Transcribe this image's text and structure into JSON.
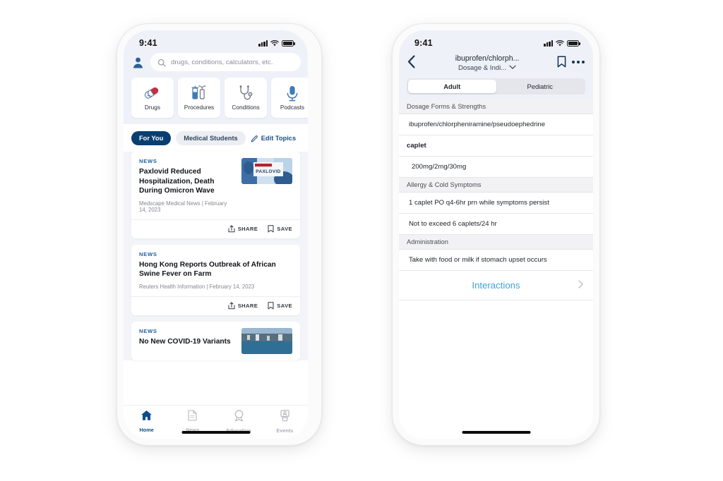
{
  "phone1": {
    "status": {
      "time": "9:41",
      "signal_icon": "cellular-bars-icon",
      "wifi_icon": "wifi-icon",
      "battery_icon": "battery-full-icon"
    },
    "header": {
      "avatar_icon": "user-avatar-icon",
      "search": {
        "icon": "search-icon",
        "placeholder": "drugs, conditions, calculators, etc.",
        "value": ""
      }
    },
    "quick_tiles": [
      {
        "label": "Drugs",
        "icon": "pills-capsule-icon"
      },
      {
        "label": "Procedures",
        "icon": "syringe-procedures-icon"
      },
      {
        "label": "Conditions",
        "icon": "stethoscope-icon"
      },
      {
        "label": "Podcasts",
        "icon": "microphone-icon"
      }
    ],
    "topics": {
      "chips": [
        {
          "label": "For You",
          "active": true
        },
        {
          "label": "Medical Students",
          "active": false
        }
      ],
      "edit_label": "Edit Topics",
      "edit_icon": "pencil-edit-icon"
    },
    "feed": [
      {
        "kicker": "NEWS",
        "headline": "Paxlovid Reduced Hospitalization, Death During Omicron Wave",
        "byline": "Medscape Medical News | February 14, 2023",
        "thumbnail": "paxlovid-box-photo",
        "share_label": "SHARE",
        "save_label": "SAVE"
      },
      {
        "kicker": "NEWS",
        "headline": "Hong Kong Reports Outbreak of African Swine Fever on Farm",
        "byline": "Reuters Health Information | February 14, 2023",
        "thumbnail": "",
        "share_label": "SHARE",
        "save_label": "SAVE"
      },
      {
        "kicker": "NEWS",
        "headline": "No New COVID-19 Variants",
        "byline": "",
        "thumbnail": "harbor-aerial-photo",
        "share_label": "SHARE",
        "save_label": "SAVE"
      }
    ],
    "tabbar": [
      {
        "label": "Home",
        "icon": "home-icon",
        "active": true
      },
      {
        "label": "News",
        "icon": "document-news-icon",
        "active": false
      },
      {
        "label": "Education",
        "icon": "award-ribbon-icon",
        "active": false
      },
      {
        "label": "Events",
        "icon": "events-calendar-icon",
        "active": false
      }
    ]
  },
  "phone2": {
    "status": {
      "time": "9:41",
      "signal_icon": "cellular-bars-icon",
      "wifi_icon": "wifi-icon",
      "battery_icon": "battery-full-icon"
    },
    "nav": {
      "back_icon": "chevron-left-icon",
      "title": "ibuprofen/chlorph...",
      "subtitle": "Dosage & Indi...",
      "subtitle_caret_icon": "chevron-down-icon",
      "bookmark_icon": "bookmark-icon",
      "more_icon": "more-horizontal-icon"
    },
    "segmented": [
      {
        "label": "Adult",
        "selected": true
      },
      {
        "label": "Pediatric",
        "selected": false
      }
    ],
    "sections": [
      {
        "header": "Dosage Forms & Strengths",
        "rows": [
          {
            "text": "ibuprofen/chlorpheniramine/pseudoephedrine",
            "style": "normal"
          },
          {
            "text": "caplet",
            "style": "bold"
          },
          {
            "text": "200mg/2mg/30mg",
            "style": "indent"
          }
        ]
      },
      {
        "header": "Allergy & Cold Symptoms",
        "rows": [
          {
            "text": "1 caplet PO q4-6hr prn while symptoms persist",
            "style": "normal"
          },
          {
            "text": "Not to exceed 6 caplets/24 hr",
            "style": "normal"
          }
        ]
      },
      {
        "header": "Administration",
        "rows": [
          {
            "text": "Take with food or milk if stomach upset occurs",
            "style": "normal"
          }
        ]
      }
    ],
    "interactions": {
      "label": "Interactions",
      "chevron_icon": "chevron-right-icon"
    }
  },
  "colors": {
    "brand_navy": "#093e70",
    "accent_blue": "#1f5fa0",
    "link_blue": "#3da2d8",
    "header_tint": "#eef1f8",
    "feed_bg": "#f3f4f7"
  }
}
